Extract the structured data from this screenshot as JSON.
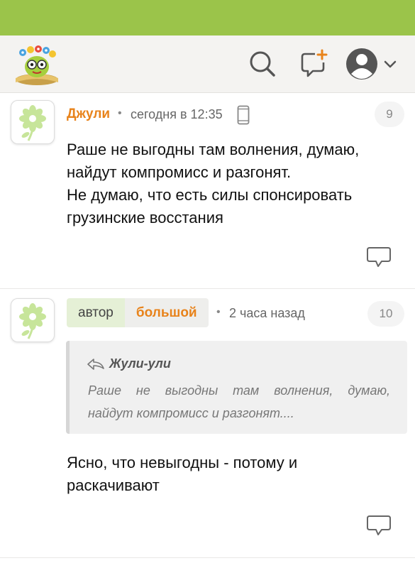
{
  "colors": {
    "topbar": "#9bc44a",
    "accent_orange": "#e8831b",
    "header_bg": "#f4f3f1"
  },
  "header": {
    "icons": [
      "logo",
      "search-icon",
      "add-post-icon",
      "user-avatar-icon",
      "chevron-down-icon"
    ]
  },
  "comments": [
    {
      "author": "Джули",
      "separator": "•",
      "time": "сегодня в 12:35",
      "device_icon": "phone-icon",
      "number": "9",
      "text_lines": [
        "Раше не выгодны там волнения, думаю,",
        "найдут компромисс и разгонят.",
        "Не думаю, что есть силы спонсировать",
        "грузинские восстания"
      ]
    },
    {
      "badge_author": "автор",
      "author": "большой",
      "separator": "•",
      "time": "2 часа назад",
      "number": "10",
      "quote": {
        "author": "Жули-ули",
        "lines": [
          "Раше не выгодны там волнения, думаю,",
          "найдут компромисс и разгонят...."
        ]
      },
      "text_lines": [
        "Ясно, что невыгодны - потому и",
        "раскачивают"
      ]
    }
  ]
}
